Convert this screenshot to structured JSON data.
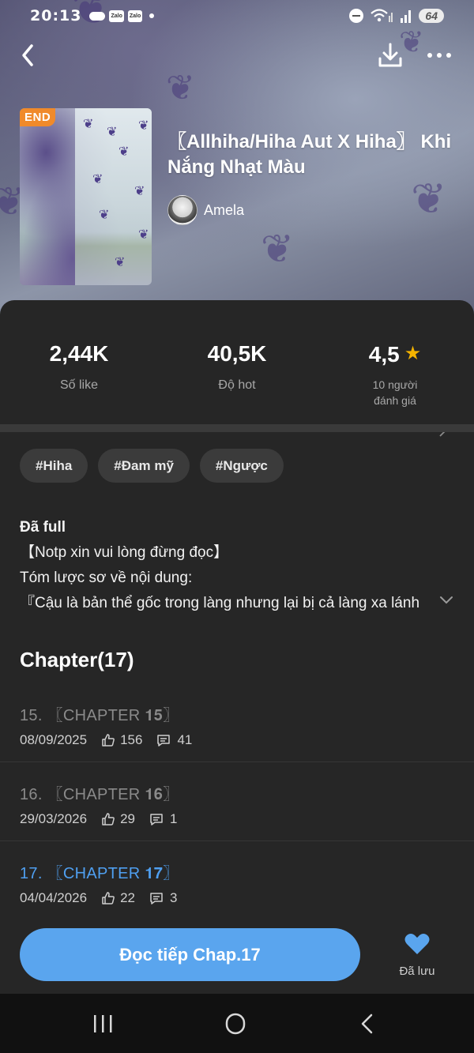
{
  "status_bar": {
    "time": "20:13",
    "zalo_1": "Zalo",
    "zalo_2": "Zalo",
    "battery": "64"
  },
  "header": {
    "end_badge": "END",
    "title": "〖Allhiha/Hiha Aut X Hiha〗 Khi Nắng Nhạt Màu",
    "author": "Amela"
  },
  "stats": {
    "likes_value": "2,44K",
    "likes_label": "Số like",
    "hot_value": "40,5K",
    "hot_label": "Độ hot",
    "rating_value": "4,5",
    "rating_label_1": "10 người",
    "rating_label_2": "đánh giá"
  },
  "tags": [
    "#Hiha",
    "#Đam mỹ",
    "#Ngược"
  ],
  "description": {
    "line1": "Đã full",
    "line2": "【Notp xin vui lòng đừng đọc】",
    "line3": "Tóm lược sơ về nội dung:",
    "line4": "『Cậu là bản thể gốc trong làng nhưng lại bị cả làng xa lánh"
  },
  "chapters_title": "Chapter(17)",
  "chapters": [
    {
      "name": "15. 〖CHAPTER 𝟏𝟓〗",
      "date": "08/09/2025",
      "likes": "156",
      "comments": "41"
    },
    {
      "name": "16. 〖CHAPTER 𝟏𝟔〗",
      "date": "29/03/2026",
      "likes": "29",
      "comments": "1"
    },
    {
      "name": "17. 〖CHAPTER 𝟏𝟕〗",
      "date": "04/04/2026",
      "likes": "22",
      "comments": "3"
    }
  ],
  "bottom": {
    "read_button": "Đọc tiếp Chap.17",
    "saved_label": "Đã lưu"
  },
  "colors": {
    "accent": "#5aa5ee",
    "active_chapter": "#4f9ff0",
    "end_badge": "#f08a2a",
    "star": "#f5b400",
    "background": "#262626"
  },
  "icons": [
    "back-icon",
    "download-icon",
    "more-icon",
    "star-icon",
    "chevron-right-icon",
    "chevron-down-icon",
    "like-icon",
    "comment-icon",
    "heart-icon"
  ]
}
